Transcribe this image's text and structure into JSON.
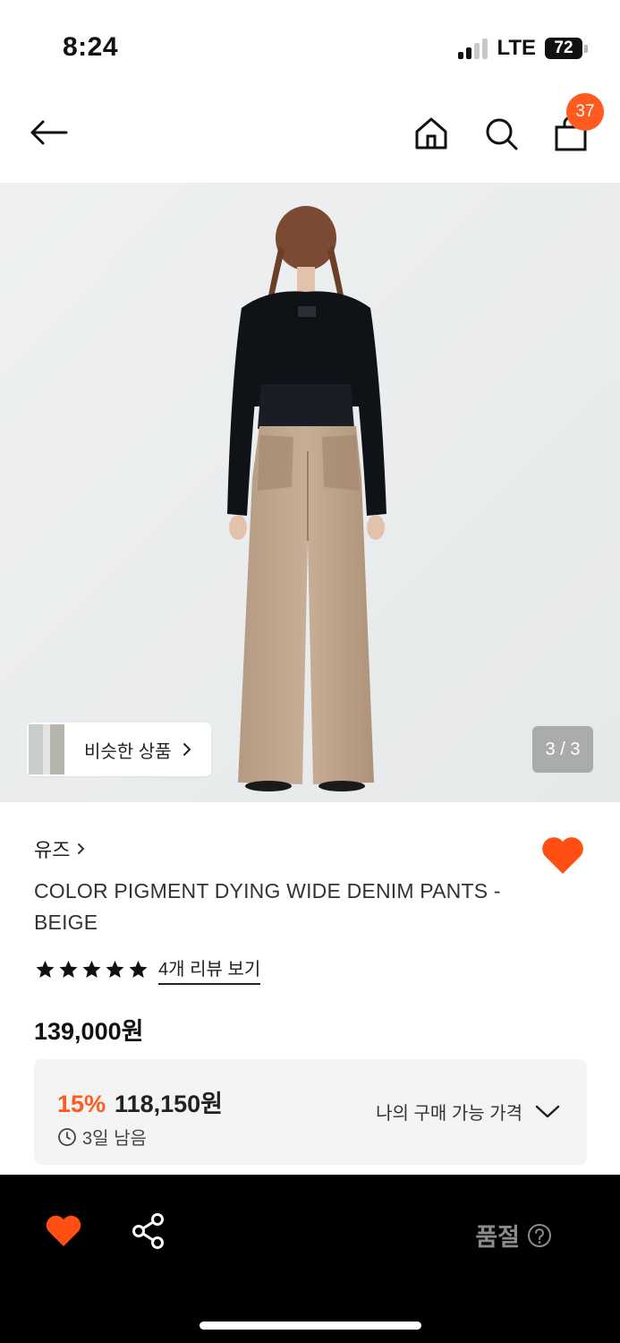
{
  "status_bar": {
    "time": "8:24",
    "network": "LTE",
    "battery": "72"
  },
  "header": {
    "cart_count": "37"
  },
  "gallery": {
    "similar_label": "비슷한 상품",
    "counter": "3 / 3"
  },
  "product": {
    "brand": "유즈",
    "title": "COLOR PIGMENT DYING WIDE DENIM PANTS - BEIGE",
    "rating_stars": 5,
    "review_link": "4개 리뷰 보기",
    "price": "139,000원"
  },
  "discount": {
    "percent": "15%",
    "price": "118,150원",
    "time_left": "3일 남음",
    "my_price_label": "나의 구매 가능 가격"
  },
  "bottom_bar": {
    "status": "품절"
  },
  "colors": {
    "accent": "#ff5a1f",
    "muted": "#8b8b8b",
    "bar": "#000000"
  }
}
